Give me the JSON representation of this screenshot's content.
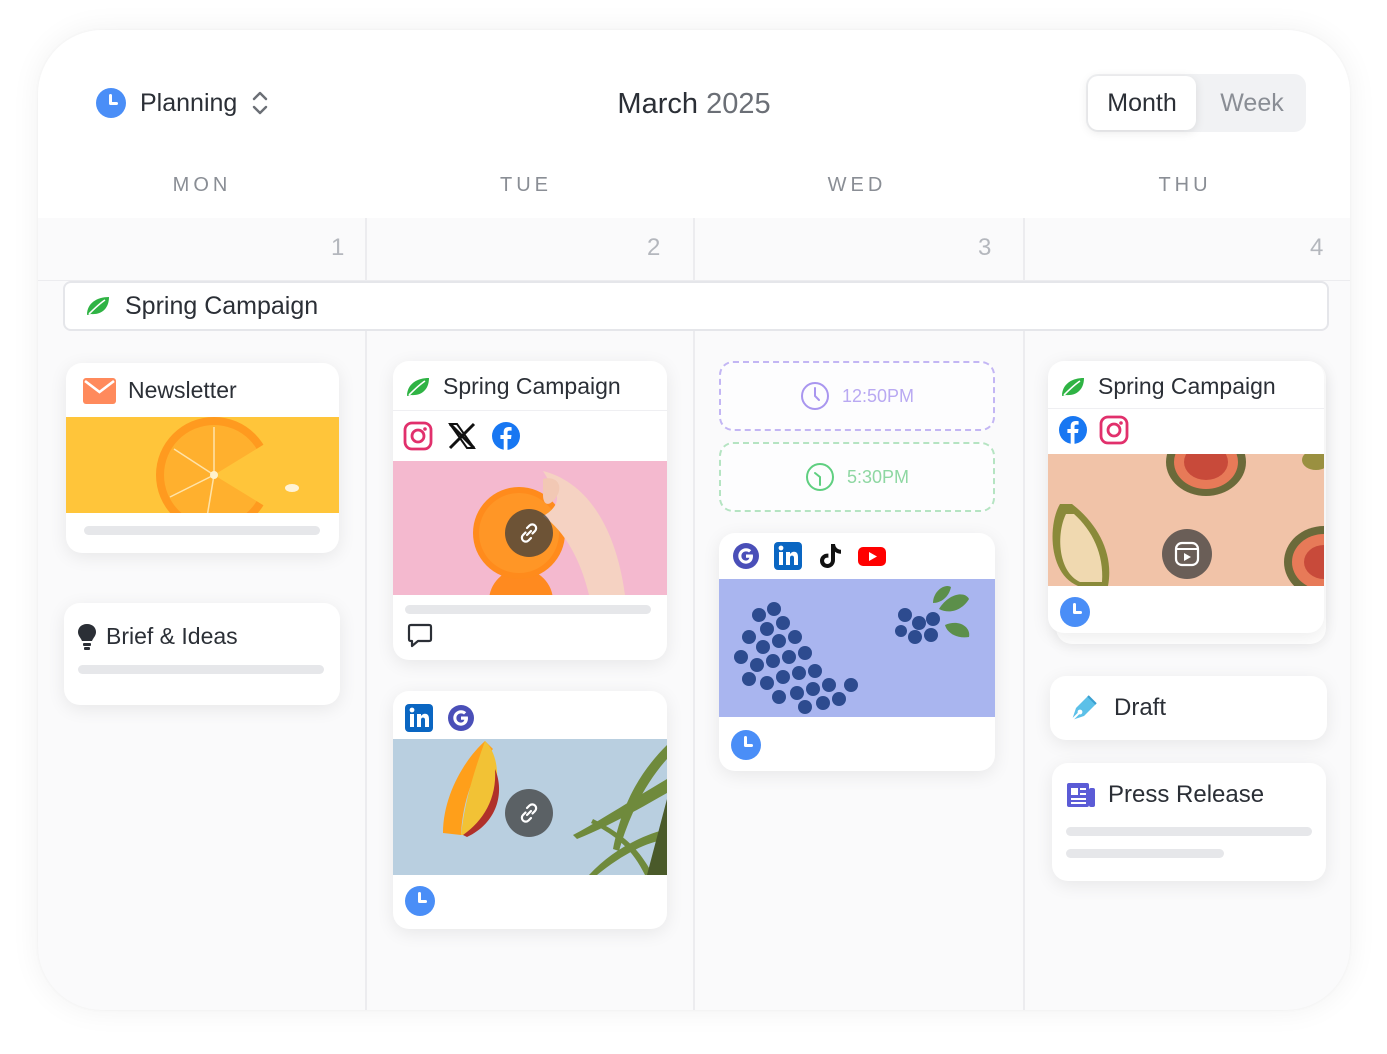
{
  "header": {
    "workspace_label": "Planning",
    "title_month": "March",
    "title_year": "2025",
    "view_toggle": {
      "month_label": "Month",
      "week_label": "Week",
      "active": "Month"
    }
  },
  "weekdays": [
    "MON",
    "TUE",
    "WED",
    "THU"
  ],
  "dates": [
    "1",
    "2",
    "3",
    "4"
  ],
  "campaign_banner": {
    "label": "Spring Campaign",
    "icon": "leaf-icon",
    "color": "#2fb344"
  },
  "monday": {
    "newsletter": {
      "title": "Newsletter",
      "icon": "mail-icon",
      "image": "orange-slice-on-yellow"
    },
    "brief": {
      "title": "Brief & Ideas",
      "icon": "lightbulb-icon"
    }
  },
  "tuesday": {
    "campaign_post": {
      "title": "Spring Campaign",
      "icons": [
        "instagram-icon",
        "x-icon",
        "facebook-icon"
      ],
      "image": "hand-holding-oranges-on-pink",
      "footer_icon": "comment-icon"
    },
    "social_post": {
      "icons": [
        "linkedin-icon",
        "google-icon"
      ],
      "image": "mango-and-pineapple-on-blue",
      "footer_icon": "clock-icon"
    }
  },
  "wednesday": {
    "slots": [
      {
        "time": "12:50PM",
        "color": "#b9a9f2"
      },
      {
        "time": "5:30PM",
        "color": "#a8e0b6"
      }
    ],
    "social_post": {
      "icons": [
        "google-icon",
        "linkedin-icon",
        "tiktok-icon",
        "youtube-icon"
      ],
      "image": "blueberries-on-lavender",
      "footer_icon": "clock-icon"
    }
  },
  "thursday": {
    "campaign_post": {
      "title": "Spring Campaign",
      "icons": [
        "facebook-icon",
        "instagram-icon"
      ],
      "image": "figs-on-peach",
      "footer_icon": "clock-icon"
    },
    "draft": {
      "title": "Draft",
      "icon": "pen-icon"
    },
    "press_release": {
      "title": "Press Release",
      "icon": "newspaper-icon"
    }
  },
  "colors": {
    "accent_blue": "#4a8ef7",
    "linkedin": "#0a66c2",
    "facebook": "#1877f2",
    "youtube": "#ff0000",
    "instagram": "#e1306c"
  }
}
